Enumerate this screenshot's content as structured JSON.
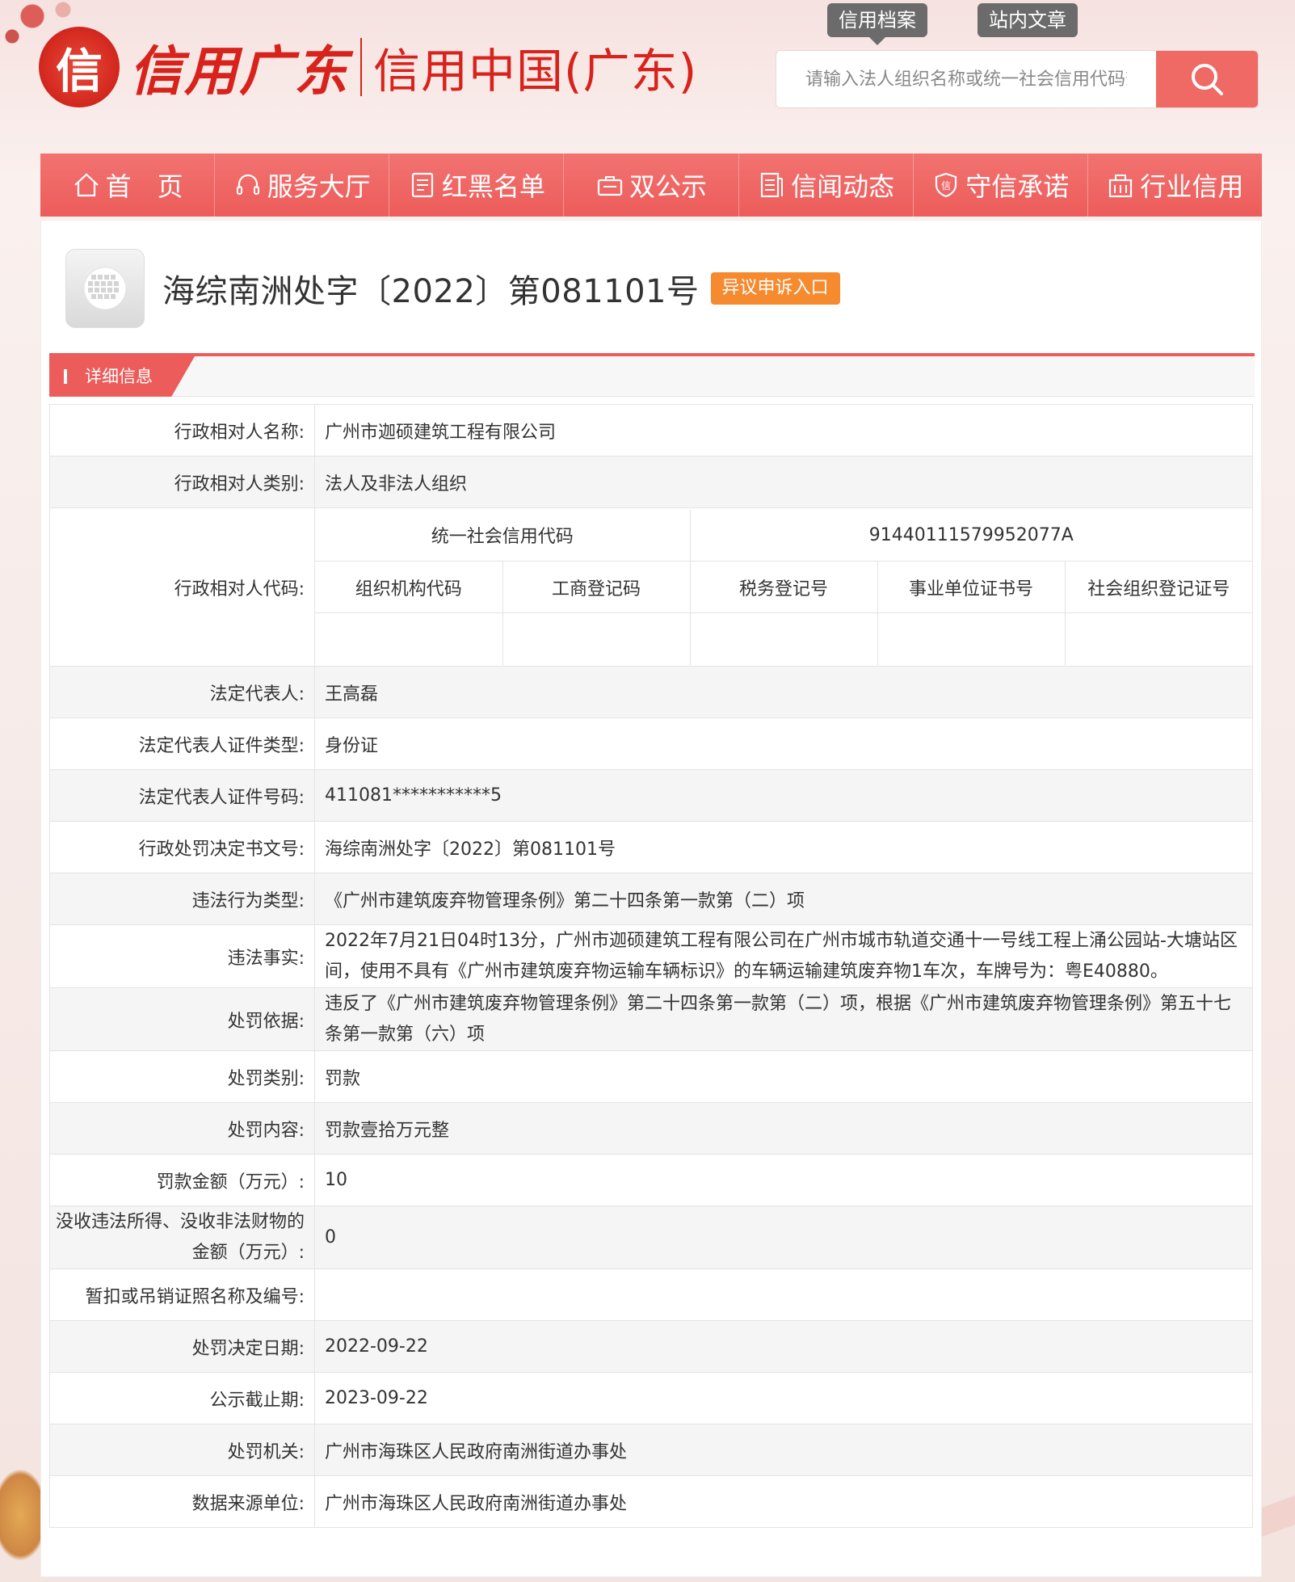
{
  "header": {
    "logo_mark": "信",
    "logo_script": "信用广东",
    "logo_text": "信用中国(广东)",
    "search_tabs": [
      "信用档案",
      "站内文章"
    ],
    "search_placeholder": "请输入法人组织名称或统一社会信用代码查询"
  },
  "nav": [
    {
      "label": "首　页",
      "icon": "home-icon"
    },
    {
      "label": "服务大厅",
      "icon": "headset-icon"
    },
    {
      "label": "红黑名单",
      "icon": "list-icon"
    },
    {
      "label": "双公示",
      "icon": "case-icon"
    },
    {
      "label": "信闻动态",
      "icon": "news-icon"
    },
    {
      "label": "守信承诺",
      "icon": "shield-icon"
    },
    {
      "label": "行业信用",
      "icon": "building-icon"
    }
  ],
  "doc": {
    "title": "海综南洲处字〔2022〕第081101号",
    "appeal": "异议申诉入口",
    "section": "详细信息"
  },
  "rows": {
    "name_label": "行政相对人名称:",
    "name_value": "广州市迦硕建筑工程有限公司",
    "type_label": "行政相对人类别:",
    "type_value": "法人及非法人组织",
    "code_label": "行政相对人代码:",
    "codes": {
      "uscc_label": "统一社会信用代码",
      "uscc_value": "91440111579952077A",
      "org_code": "组织机构代码",
      "biz_reg": "工商登记码",
      "tax_reg": "税务登记号",
      "inst_cert": "事业单位证书号",
      "social_reg": "社会组织登记证号"
    },
    "legal_rep_label": "法定代表人:",
    "legal_rep_value": "王高磊",
    "id_type_label": "法定代表人证件类型:",
    "id_type_value": "身份证",
    "id_no_label": "法定代表人证件号码:",
    "id_no_value": "411081***********5",
    "doc_no_label": "行政处罚决定书文号:",
    "doc_no_value": "海综南洲处字〔2022〕第081101号",
    "violation_type_label": "违法行为类型:",
    "violation_type_value": "《广州市建筑废弃物管理条例》第二十四条第一款第（二）项",
    "facts_label": "违法事实:",
    "facts_value": "2022年7月21日04时13分，广州市迦硕建筑工程有限公司在广州市城市轨道交通十一号线工程上涌公园站-大塘站区间，使用不具有《广州市建筑废弃物运输车辆标识》的车辆运输建筑废弃物1车次，车牌号为：粤E40880。",
    "basis_label": "处罚依据:",
    "basis_value": "违反了《广州市建筑废弃物管理条例》第二十四条第一款第（二）项，根据《广州市建筑废弃物管理条例》第五十七条第一款第（六）项",
    "category_label": "处罚类别:",
    "category_value": "罚款",
    "content_label": "处罚内容:",
    "content_value": "罚款壹拾万元整",
    "fine_label": "罚款金额（万元）:",
    "fine_value": "10",
    "confiscate_label": "没收违法所得、没收非法财物的金额（万元）:",
    "confiscate_value": "0",
    "license_label": "暂扣或吊销证照名称及编号:",
    "license_value": "",
    "decision_date_label": "处罚决定日期:",
    "decision_date_value": "2022-09-22",
    "deadline_label": "公示截止期:",
    "deadline_value": "2023-09-22",
    "authority_label": "处罚机关:",
    "authority_value": "广州市海珠区人民政府南洲街道办事处",
    "source_label": "数据来源单位:",
    "source_value": "广州市海珠区人民政府南洲街道办事处"
  },
  "colors": {
    "nav": "#ec5c5a",
    "brand_red": "#d8231c",
    "appeal": "#f58a2f"
  }
}
